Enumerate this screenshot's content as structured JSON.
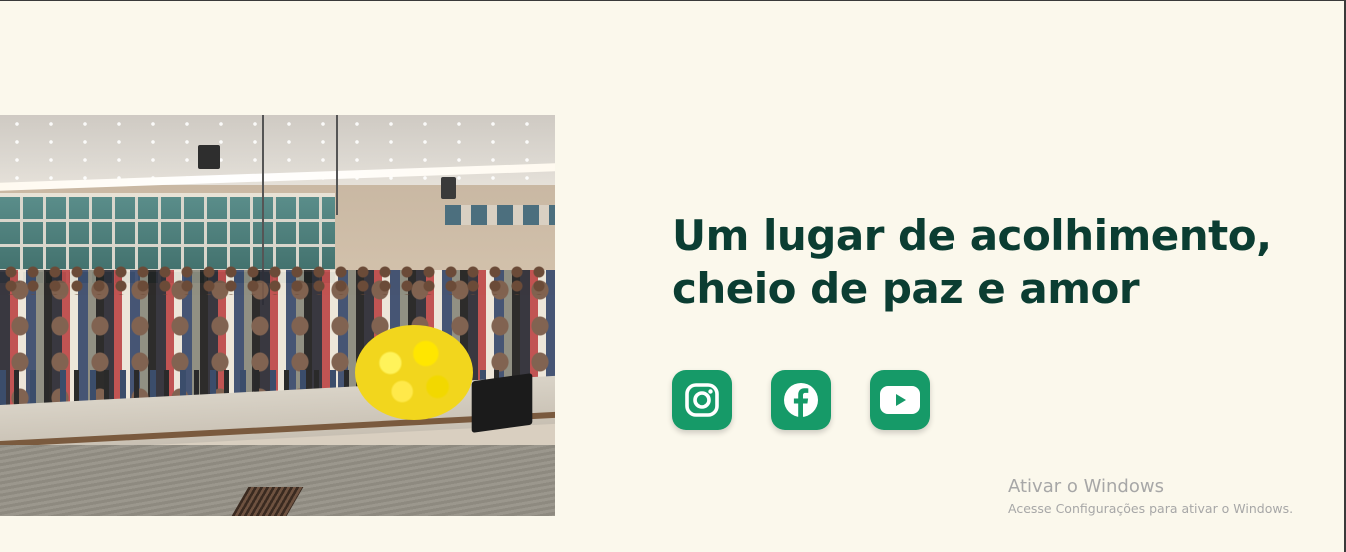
{
  "hero": {
    "photo_icon": "church-congregation-photo",
    "headline_line1": "Um lugar de acolhimento,",
    "headline_line2": "cheio de paz e amor"
  },
  "social": [
    {
      "icon": "instagram-icon"
    },
    {
      "icon": "facebook-icon"
    },
    {
      "icon": "youtube-icon"
    }
  ],
  "colors": {
    "background": "#fbf8ec",
    "headline": "#0b3d32",
    "accent": "#169a68"
  },
  "watermark": {
    "title": "Ativar o Windows",
    "subtitle": "Acesse Configurações para ativar o Windows."
  }
}
